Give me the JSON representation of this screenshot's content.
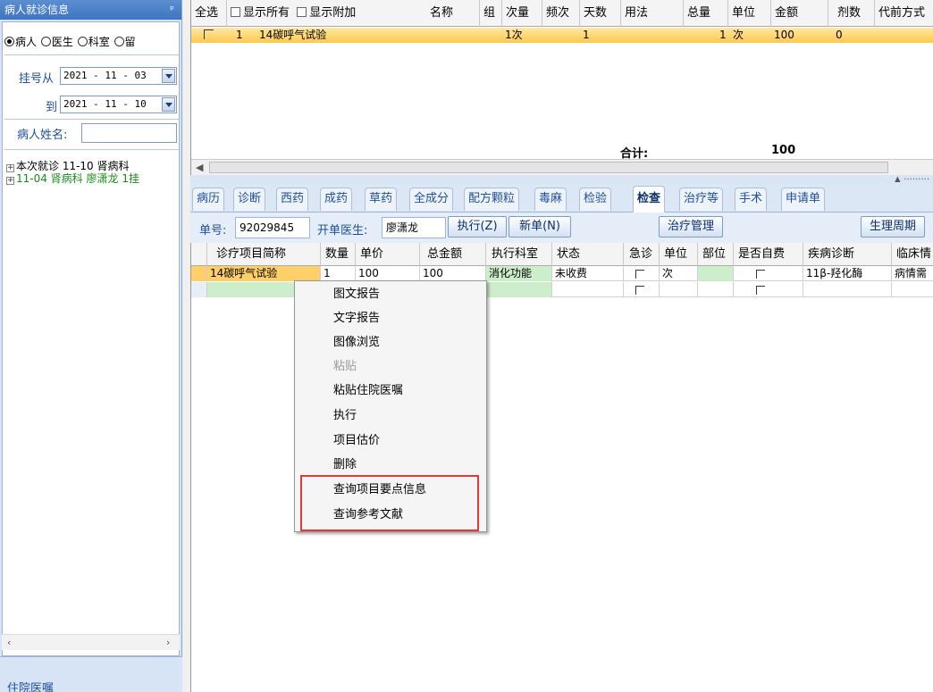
{
  "left_panel": {
    "title": "病人就诊信息",
    "pin": "ᵖ",
    "radios": [
      {
        "label": "病人",
        "checked": true
      },
      {
        "label": "医生",
        "checked": false
      },
      {
        "label": "科室",
        "checked": false
      },
      {
        "label": "留",
        "checked": false
      }
    ],
    "from_label": "挂号从",
    "from_date": "2021 - 11 - 03",
    "to_label": "到",
    "to_date": "2021 - 11 - 10",
    "name_label": "病人姓名:",
    "name_value": "",
    "tree": [
      {
        "expander": "+",
        "text": "本次就诊 11-10 肾病科",
        "color": "#000000"
      },
      {
        "expander": "+",
        "text": "11-04 肾病科 廖潇龙 1挂",
        "color": "#1a8c1a"
      }
    ],
    "scroll_left": "‹",
    "scroll_right": "›",
    "footer": "住院医嘱"
  },
  "top_grid": {
    "headers": [
      "全选",
      "显示所有",
      "显示附加",
      "名称",
      "组",
      "次量",
      "频次",
      "天数",
      "用法",
      "总量",
      "单位",
      "金额",
      "剂数",
      "代前方式"
    ],
    "row": {
      "seq": "1",
      "name": "14碳呼气试验",
      "dose": "1次",
      "freq": "1",
      "total": "1",
      "unit": "次",
      "amount": "100",
      "doses": "0"
    },
    "total_label": "合计:",
    "total_value": "100"
  },
  "tabs": [
    "病历",
    "诊断",
    "西药",
    "成药",
    "草药",
    "全成分",
    "配方颗粒",
    "毒麻",
    "检验",
    "检查",
    "治疗等",
    "手术",
    "申请单"
  ],
  "active_tab": "检查",
  "toolbar": {
    "order_label": "单号:",
    "order_no": "92029845",
    "doctor_label": "开单医生:",
    "doctor": "廖潇龙",
    "execute_btn": "执行(Z)",
    "new_btn": "新单(N)",
    "treatment_btn": "治疗管理",
    "cycle_btn": "生理周期"
  },
  "lower_grid": {
    "headers": [
      "诊疗项目简称",
      "数量",
      "单价",
      "总金额",
      "执行科室",
      "状态",
      "急诊",
      "单位",
      "部位",
      "是否自费",
      "疾病诊断",
      "临床情"
    ],
    "rows": [
      {
        "name": "14碳呼气试验",
        "qty": "1",
        "price": "100",
        "amount": "100",
        "dept": "消化功能",
        "status": "未收费",
        "unit": "次",
        "diagnosis": "11β-羟化酶",
        "clinical": "病情需"
      }
    ]
  },
  "context_menu": {
    "items": [
      {
        "label": "图文报告",
        "disabled": false
      },
      {
        "label": "文字报告",
        "disabled": false
      },
      {
        "label": "图像浏览",
        "disabled": false
      },
      {
        "label": "粘贴",
        "disabled": true
      },
      {
        "label": "粘贴住院医嘱",
        "disabled": false
      },
      {
        "label": "执行",
        "disabled": false
      },
      {
        "label": "项目估价",
        "disabled": false
      },
      {
        "label": "删除",
        "disabled": false
      },
      {
        "label": "查询项目要点信息",
        "disabled": false
      },
      {
        "label": "查询参考文献",
        "disabled": false
      }
    ]
  },
  "colors": {
    "highlight": "#e53935",
    "selected_row": "#ffcf6a",
    "dept_cell": "#cdeecb"
  }
}
